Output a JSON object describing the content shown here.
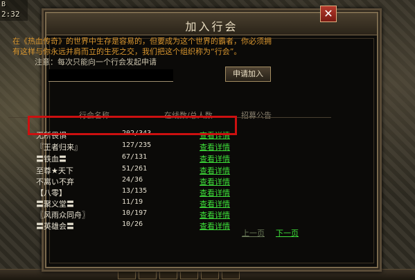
{
  "hud": {
    "date": "B",
    "time": "2:32"
  },
  "dialog": {
    "title": "加入行会",
    "close_icon": "✕",
    "intro_line1": "在《热血传奇》的世界中生存是容易的，但要成为这个世界的霸者，你必须拥",
    "intro_line2": "有这样与你永远并肩而立的生死之交，我们把这个组织称为“行会”。",
    "notice": "注意：每次只能向一个行会发起申请",
    "input_value": "",
    "apply_label": "申请加入"
  },
  "table": {
    "headers": {
      "name": "行会名称",
      "members": "在线数/总人数",
      "recruit": "招募公告"
    },
    "rows": [
      {
        "name": "无所畏惧",
        "members": "202/343",
        "details": "查看详情"
      },
      {
        "name": "『王者归来』",
        "members": "127/235",
        "details": "查看详情"
      },
      {
        "name": "〓铁血〓",
        "members": "67/131",
        "details": "查看详情"
      },
      {
        "name": "至尊★天下",
        "members": "51/261",
        "details": "查看详情"
      },
      {
        "name": "不离い不弃",
        "members": "24/36",
        "details": "查看详情"
      },
      {
        "name": "【八零】",
        "members": "13/135",
        "details": "查看详情"
      },
      {
        "name": "〓聚义堂〓",
        "members": "11/19",
        "details": "查看详情"
      },
      {
        "name": "〖风雨众同舟〗",
        "members": "10/197",
        "details": "查看详情"
      },
      {
        "name": "〓英雄会〓",
        "members": "10/26",
        "details": "查看详情"
      }
    ]
  },
  "pagination": {
    "prev": "上一页",
    "next": "下一页"
  },
  "colors": {
    "highlight": "#cc1010",
    "link": "#3ee03a",
    "intro": "#d9962f"
  }
}
